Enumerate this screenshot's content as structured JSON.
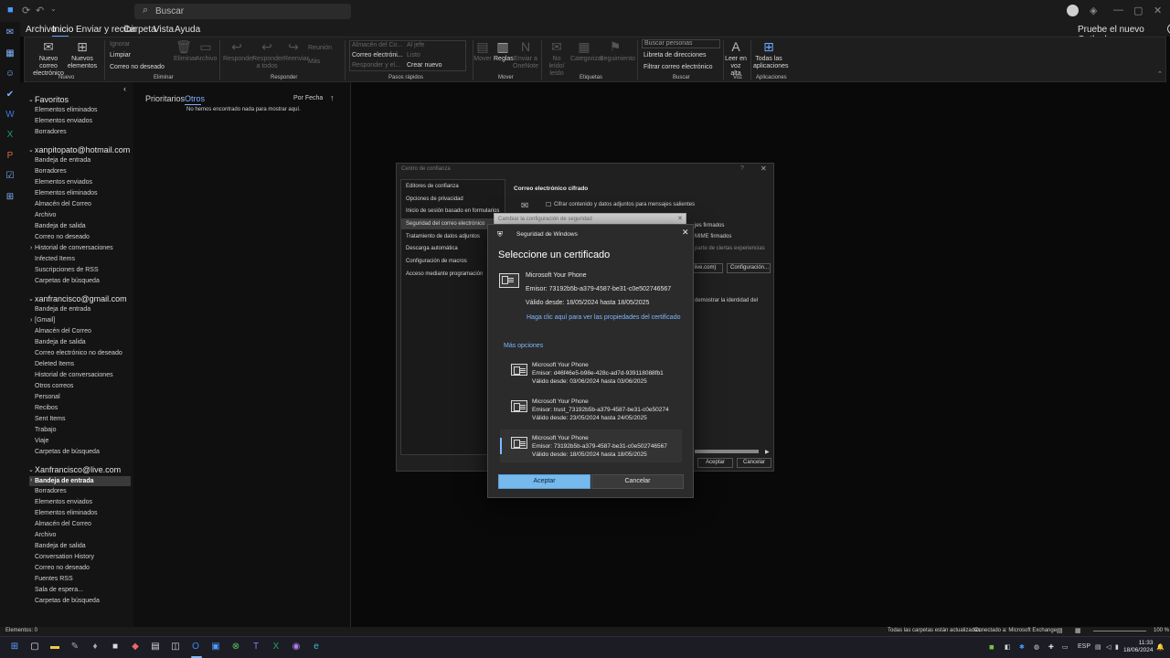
{
  "titlebar": {
    "search_placeholder": "Buscar"
  },
  "menu": {
    "tabs": [
      "Archivo",
      "Inicio",
      "Enviar y recibir",
      "Carpeta",
      "Vista",
      "Ayuda"
    ],
    "active": "Inicio",
    "try_new": "Pruebe el nuevo Outlook"
  },
  "ribbon": {
    "new_mail": "Nuevo correo electrónico",
    "new_items": "Nuevos elementos",
    "ignore": "Ignorar",
    "clean": "Limpiar",
    "junk": "Correo no deseado",
    "delete": "Eliminar",
    "archive": "Archivo",
    "reply": "Responder",
    "reply_all": "Responder a todos",
    "forward": "Reenviar",
    "meeting": "Reunión",
    "more": "Más",
    "qs_manager": "Almacén del Co...",
    "qs_email": "Correo electróni...",
    "qs_reply": "Responder y el...",
    "qs_boss": "Al jefe",
    "qs_done": "Listo",
    "qs_create": "Crear nuevo",
    "move": "Mover",
    "rules": "Reglas",
    "onenote": "Enviar a OneNote",
    "unread": "No leído/ leído",
    "categorize": "Categorizar",
    "followup": "Seguimiento",
    "search_people": "Buscar personas",
    "address_book": "Libreta de direcciones",
    "filter_mail": "Filtrar correo electrónico",
    "read_aloud": "Leer en voz alta",
    "all_apps": "Todas las aplicaciones",
    "groups": {
      "new": "Nuevo",
      "delete": "Eliminar",
      "respond": "Responder",
      "quicksteps": "Pasos rápidos",
      "move": "Mover",
      "tags": "Etiquetas",
      "find": "Buscar",
      "voice": "Voz",
      "apps": "Aplicaciones"
    }
  },
  "folders": {
    "favorites": {
      "title": "Favoritos",
      "items": [
        "Elementos eliminados",
        "Elementos enviados",
        "Borradores"
      ]
    },
    "hotmail": {
      "title": "xanpitopato@hotmail.com",
      "items": [
        "Bandeja de entrada",
        "Borradores",
        "Elementos enviados",
        "Elementos eliminados",
        "Almacén del Correo",
        "Archivo",
        "Bandeja de salida",
        "Correo no deseado",
        "Historial de conversaciones",
        "Infected Items",
        "Suscripciones de RSS",
        "Carpetas de búsqueda"
      ]
    },
    "gmail": {
      "title": "xanfrancisco@gmail.com",
      "items": [
        "Bandeja de entrada",
        "[Gmail]",
        "Almacén del Correo",
        "Bandeja de salida",
        "Correo electrónico no deseado",
        "Deleted Items",
        "Historial de conversaciones",
        "Otros correos",
        "Personal",
        "Recibos",
        "Sent Items",
        "Trabajo",
        "Viaje",
        "Carpetas de búsqueda"
      ]
    },
    "live": {
      "title": "Xanfrancisco@live.com",
      "items": [
        "Bandeja de entrada",
        "Borradores",
        "Elementos enviados",
        "Elementos eliminados",
        "Almacén del Correo",
        "Archivo",
        "Bandeja de salida",
        "Conversation History",
        "Correo no deseado",
        "Fuentes RSS",
        "Sala de espera...",
        "Carpetas de búsqueda"
      ]
    }
  },
  "maillist": {
    "tab_focused": "Prioritarios",
    "tab_other": "Otros",
    "sort": "Por Fecha",
    "empty": "No hemos encontrado nada para mostrar aquí."
  },
  "trust_center": {
    "title": "Centro de confianza",
    "nav": [
      "Editores de confianza",
      "Opciones de privacidad",
      "Inicio de sesión basado en formularios",
      "Seguridad del correo electrónico",
      "Tratamiento de datos adjuntos",
      "Descarga automática",
      "Configuración de macros",
      "Acceso mediante programación"
    ],
    "heading": "Correo electrónico cifrado",
    "encrypt_option": "Cifrar contenido y datos adjuntos para mensajes salientes",
    "signed": "jes firmados",
    "smime": "MIME firmados",
    "some_exp": "parte de ciertas experiencias",
    "account": "live.com)",
    "config_btn": "Configuración...",
    "identity": "demostrar la identidad del",
    "accept": "Aceptar",
    "cancel": "Cancelar"
  },
  "change_security": {
    "title": "Cambiar la configuración de seguridad"
  },
  "windows_security": {
    "title": "Seguridad de Windows",
    "heading": "Seleccione un certificado",
    "main_cert": {
      "name": "Microsoft Your Phone",
      "issuer": "Emisor: 73192b5b-a379-4587-be31-c0e502746567",
      "valid": "Válido desde: 18/05/2024 hasta 18/05/2025"
    },
    "cert_link": "Haga clic aquí para ver las propiedades del certificado",
    "more_options": "Más opciones",
    "options": [
      {
        "name": "Microsoft Your Phone",
        "issuer": "Emisor: d46f46e5-b98e-428c-ad7d-939118088fb1",
        "valid": "Válido desde: 03/06/2024 hasta 03/06/2025"
      },
      {
        "name": "Microsoft Your Phone",
        "issuer": "Emisor: trust_73192b5b-a379-4587-be31-c0e50274",
        "valid": "Válido desde: 23/05/2024 hasta 24/05/2025"
      },
      {
        "name": "Microsoft Your Phone",
        "issuer": "Emisor: 73192b5b-a379-4587-be31-c0e502746567",
        "valid": "Válido desde: 18/05/2024 hasta 18/05/2025"
      }
    ],
    "accept": "Aceptar",
    "cancel": "Cancelar"
  },
  "statusbar": {
    "items": "Elementos: 0",
    "folders_updated": "Todas las carpetas están actualizadas.",
    "connected": "Conectado a: Microsoft Exchange",
    "zoom": "100 %"
  },
  "taskbar": {
    "lang": "ESP",
    "time": "11:33",
    "date": "18/06/2024"
  },
  "colors": {
    "accent": "#76b9ed",
    "link": "#7db8ff"
  }
}
